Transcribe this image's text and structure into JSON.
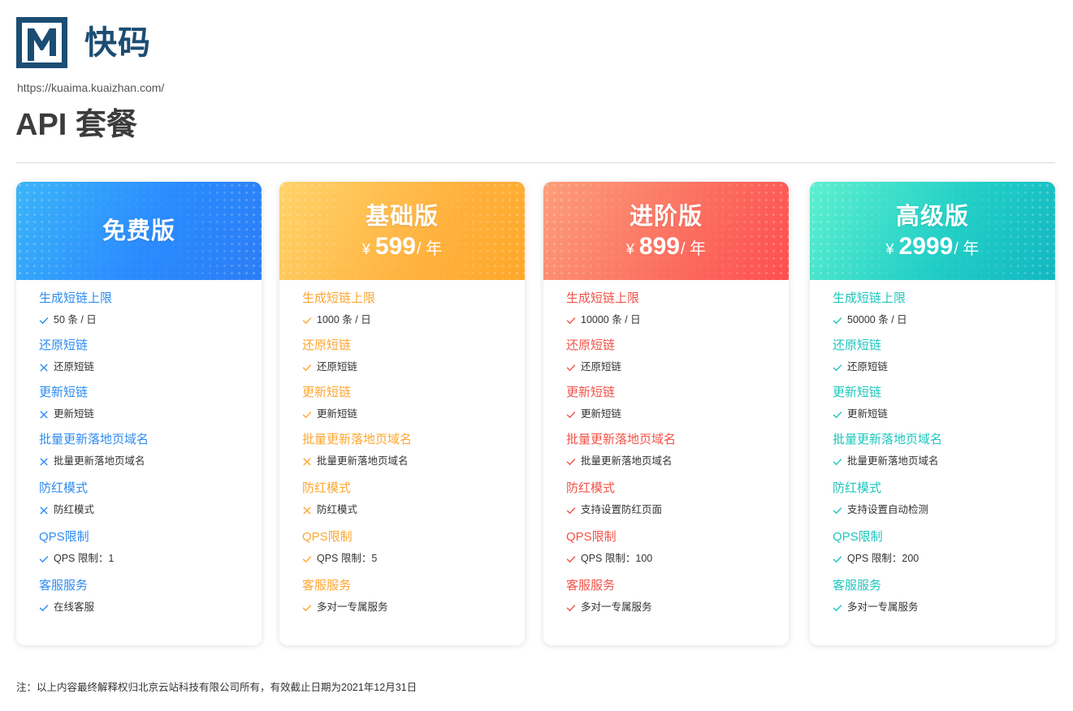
{
  "brand": {
    "name": "快码",
    "url": "https://kuaima.kuaizhan.com/"
  },
  "page_title": "API 套餐",
  "colors": {
    "free": "#2d8cf0",
    "basic": "#ffa630",
    "advanced": "#f35247",
    "premium": "#1ec6bd",
    "brand": "#1b4d73"
  },
  "plans": [
    {
      "name": "免费版",
      "features": [
        {
          "title": "生成短链上限",
          "value": "50 条 / 日",
          "included": true
        },
        {
          "title": "还原短链",
          "value": "还原短链",
          "included": false
        },
        {
          "title": "更新短链",
          "value": "更新短链",
          "included": false
        },
        {
          "title": "批量更新落地页域名",
          "value": "批量更新落地页域名",
          "included": false
        },
        {
          "title": "防红模式",
          "value": "防红模式",
          "included": false
        },
        {
          "title": "QPS限制",
          "value": "QPS 限制：1",
          "included": true
        },
        {
          "title": "客服服务",
          "value": "在线客服",
          "included": true
        }
      ]
    },
    {
      "name": "基础版",
      "price": {
        "currency": "¥",
        "amount": "599",
        "unit": "/ 年"
      },
      "features": [
        {
          "title": "生成短链上限",
          "value": "1000 条 / 日",
          "included": true
        },
        {
          "title": "还原短链",
          "value": "还原短链",
          "included": true
        },
        {
          "title": "更新短链",
          "value": "更新短链",
          "included": true
        },
        {
          "title": "批量更新落地页域名",
          "value": "批量更新落地页域名",
          "included": false
        },
        {
          "title": "防红模式",
          "value": "防红模式",
          "included": false
        },
        {
          "title": "QPS限制",
          "value": "QPS 限制：5",
          "included": true
        },
        {
          "title": "客服服务",
          "value": "多对一专属服务",
          "included": true
        }
      ]
    },
    {
      "name": "进阶版",
      "price": {
        "currency": "¥",
        "amount": "899",
        "unit": "/ 年"
      },
      "features": [
        {
          "title": "生成短链上限",
          "value": "10000 条 / 日",
          "included": true
        },
        {
          "title": "还原短链",
          "value": "还原短链",
          "included": true
        },
        {
          "title": "更新短链",
          "value": "更新短链",
          "included": true
        },
        {
          "title": "批量更新落地页域名",
          "value": "批量更新落地页域名",
          "included": true
        },
        {
          "title": "防红模式",
          "value": "支持设置防红页面",
          "included": true
        },
        {
          "title": "QPS限制",
          "value": "QPS 限制：100",
          "included": true
        },
        {
          "title": "客服服务",
          "value": "多对一专属服务",
          "included": true
        }
      ]
    },
    {
      "name": "高级版",
      "price": {
        "currency": "¥",
        "amount": "2999",
        "unit": "/ 年"
      },
      "features": [
        {
          "title": "生成短链上限",
          "value": "50000 条 / 日",
          "included": true
        },
        {
          "title": "还原短链",
          "value": "还原短链",
          "included": true
        },
        {
          "title": "更新短链",
          "value": "更新短链",
          "included": true
        },
        {
          "title": "批量更新落地页域名",
          "value": "批量更新落地页域名",
          "included": true
        },
        {
          "title": "防红模式",
          "value": "支持设置自动检测",
          "included": true
        },
        {
          "title": "QPS限制",
          "value": "QPS 限制：200",
          "included": true
        },
        {
          "title": "客服服务",
          "value": "多对一专属服务",
          "included": true
        }
      ]
    }
  ],
  "footnote": "注：以上内容最终解释权归北京云站科技有限公司所有，有效截止日期为2021年12月31日"
}
